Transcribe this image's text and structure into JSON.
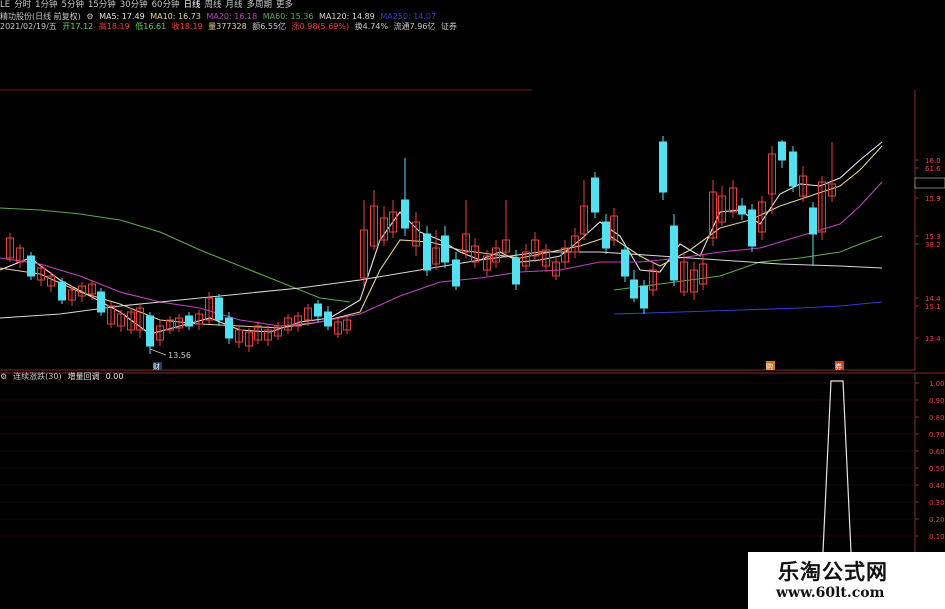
{
  "toolbar": {
    "items": [
      "LE",
      "分时",
      "1分钟",
      "5分钟",
      "15分钟",
      "30分钟",
      "60分钟",
      "日线",
      "周线",
      "月线",
      "多周期",
      "更多"
    ],
    "active_index": 7
  },
  "info_line1": {
    "stock": "精功股份(日线 前复权)",
    "ma5": "MA5: 17.49",
    "ma10": "MA10: 16.73",
    "ma20": "MA20: 16.18",
    "ma60": "MA60: 15.36",
    "ma120": "MA120: 14.89",
    "ma250": "MA250: 14.07"
  },
  "info_line2": {
    "date": "2021/02/19/五",
    "open": "开17.12",
    "high": "高18.19",
    "low": "低16.61",
    "close": "收18.19",
    "volume": "量377328",
    "amount": "额6.55亿",
    "change": "涨0.98(5.69%)",
    "turnover": "换4.74%",
    "float_cap": "流通7.96亿",
    "security": "证券"
  },
  "price_axis": [
    "16.0",
    "61.6",
    "16.06",
    "15.9",
    "15.3",
    "38.2",
    "14.4",
    "15.1",
    "13.4"
  ],
  "marks": {
    "low_label": "13.56",
    "badge_b": "财",
    "badge_1": "购",
    "badge_2": "券"
  },
  "indicator": {
    "name": "连续涨跌(30)",
    "label": "增量回调",
    "value": "0.00",
    "axis": [
      "1.00",
      "0.90",
      "0.80",
      "0.70",
      "0.60",
      "0.50",
      "0.40",
      "0.30",
      "0.20",
      "0.10"
    ]
  },
  "watermark": {
    "title": "乐淘公式网",
    "url": "www.60lt.com"
  },
  "colors": {
    "up": "#e8413f",
    "down": "#53e0f0",
    "ma5": "#e6e6e6",
    "ma10": "#e6d28a",
    "ma20": "#c040c0",
    "ma60": "#5aaa4a",
    "ma120": "#2f3fd0"
  }
}
